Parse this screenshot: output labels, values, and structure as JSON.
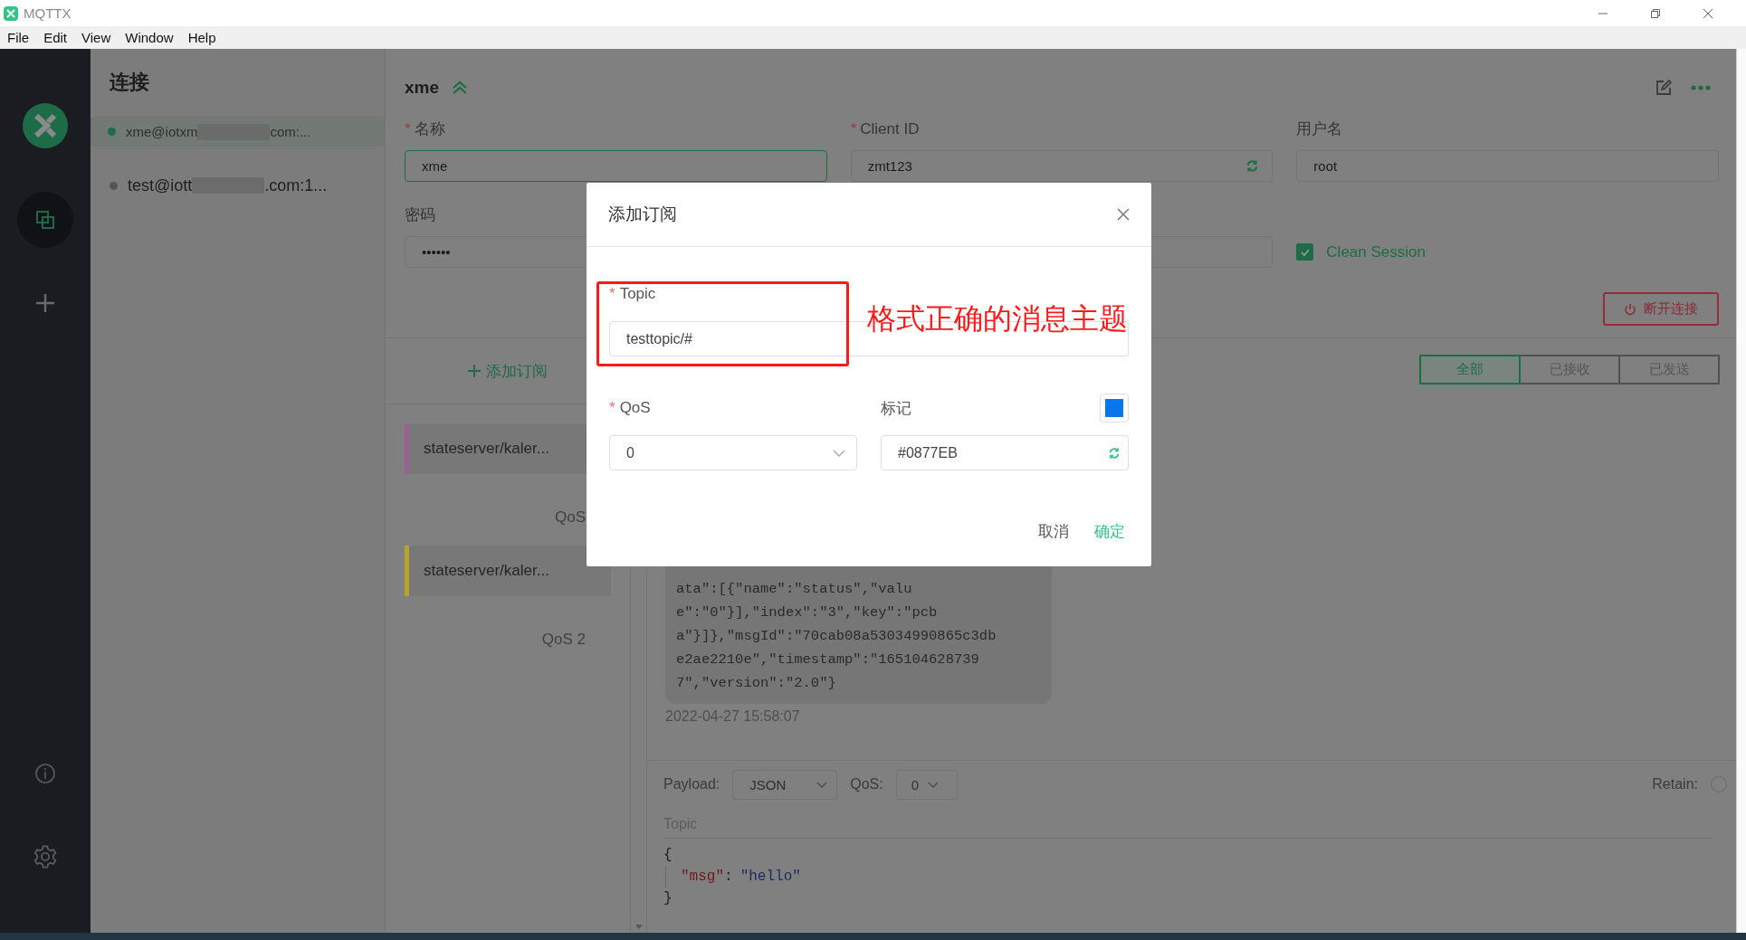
{
  "window": {
    "title": "MQTTX"
  },
  "menu": [
    "File",
    "Edit",
    "View",
    "Window",
    "Help"
  ],
  "nav": [
    {
      "kind": "connections",
      "selected": true
    },
    {
      "kind": "new",
      "selected": false
    }
  ],
  "connections": {
    "title": "连接",
    "items": [
      {
        "start": "xme@iotxm",
        "end": "com:...",
        "redacted": true,
        "online": true,
        "selected": true
      },
      {
        "start": "test@iott",
        "end": ".com:1...",
        "redacted": true,
        "online": false,
        "selected": false
      }
    ]
  },
  "connection": {
    "name": "xme",
    "fields": [
      {
        "mark": "*",
        "label": "名称",
        "value": "xme",
        "focused": true
      },
      {
        "mark": "*",
        "label": "Client ID",
        "value": "zmt123",
        "focused": false,
        "refresh": true
      },
      {
        "label": "用户名",
        "value": "root",
        "focused": false
      },
      {
        "label": "密码",
        "value": "••••••",
        "focused": false
      },
      {
        "focused": false
      }
    ],
    "clean_session": {
      "label": "Clean Session",
      "checked": true
    },
    "disconnect": "断开连接"
  },
  "subscriptions": {
    "add": "添加订阅",
    "items": [
      {
        "topic": "stateserver/kaler...",
        "qos": "QoS",
        "color": "#9c5f96"
      },
      {
        "topic": "stateserver/kaler...",
        "qos": "QoS 2",
        "color": "#b5a42c"
      }
    ]
  },
  "message_filter": [
    {
      "label": "全部",
      "selected": true
    },
    {
      "label": "已接收",
      "selected": false
    },
    {
      "label": "已发送",
      "selected": false
    }
  ],
  "message": {
    "lines": [
      "ata\":[{\"name\":\"status\",\"valu",
      "e\":\"0\"}],\"index\":\"3\",\"key\":\"pcb",
      "a\"}]},\"msgId\":\"70cab08a53034990865c3db",
      "e2ae2210e\",\"timestamp\":\"165104628739",
      "7\",\"version\":\"2.0\"}"
    ],
    "time": "2022-04-27 15:58:07"
  },
  "publish": {
    "payload_label": "Payload:",
    "payload_format": "JSON",
    "qos_label": "QoS:",
    "qos": "0",
    "retain_label": "Retain:",
    "retain": false,
    "topic_placeholder": "Topic",
    "body": [
      [
        {
          "kind": "punct",
          "text": "{"
        }
      ],
      [
        {
          "kind": "key",
          "text": "\"msg\""
        },
        {
          "kind": "punct",
          "text": ":"
        },
        {
          "kind": "string",
          "text": "\"hello\""
        }
      ],
      [
        {
          "kind": "punct",
          "text": "}"
        }
      ]
    ]
  },
  "dialog": {
    "title": "添加订阅",
    "topic": {
      "mark": "*",
      "label": "Topic",
      "value": "testtopic/#"
    },
    "qos": {
      "mark": "*",
      "label": "QoS",
      "value": "0"
    },
    "tag": {
      "label": "标记",
      "value": "#0877EB",
      "color": "#0877eb"
    },
    "cancel": "取消",
    "confirm": "确定"
  },
  "annotation": {
    "text": "格式正确的消息主题"
  }
}
